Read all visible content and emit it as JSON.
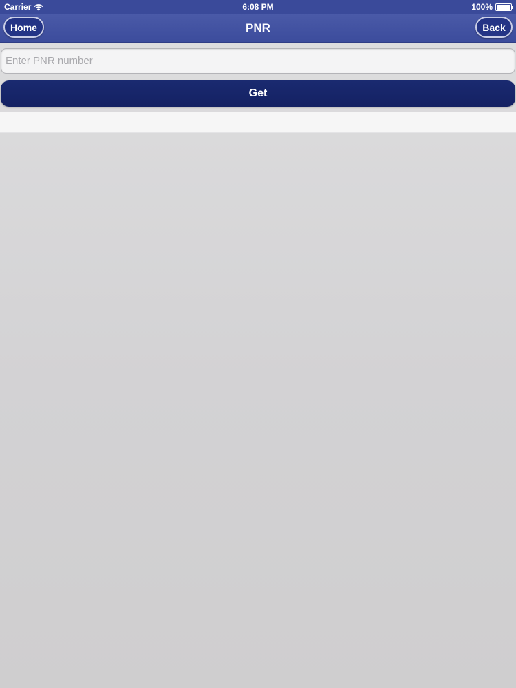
{
  "status_bar": {
    "carrier": "Carrier",
    "time": "6:08 PM",
    "battery": "100%",
    "icons": [
      "wifi-icon",
      "battery-icon"
    ]
  },
  "nav_bar": {
    "title": "PNR",
    "home_label": "Home",
    "back_label": "Back"
  },
  "form": {
    "pnr_placeholder": "Enter PNR number",
    "pnr_value": "",
    "get_label": "Get"
  },
  "colors": {
    "nav_background": "#3c4c9c",
    "button_dark": "#142163",
    "page_background": "#d6d5d7"
  }
}
